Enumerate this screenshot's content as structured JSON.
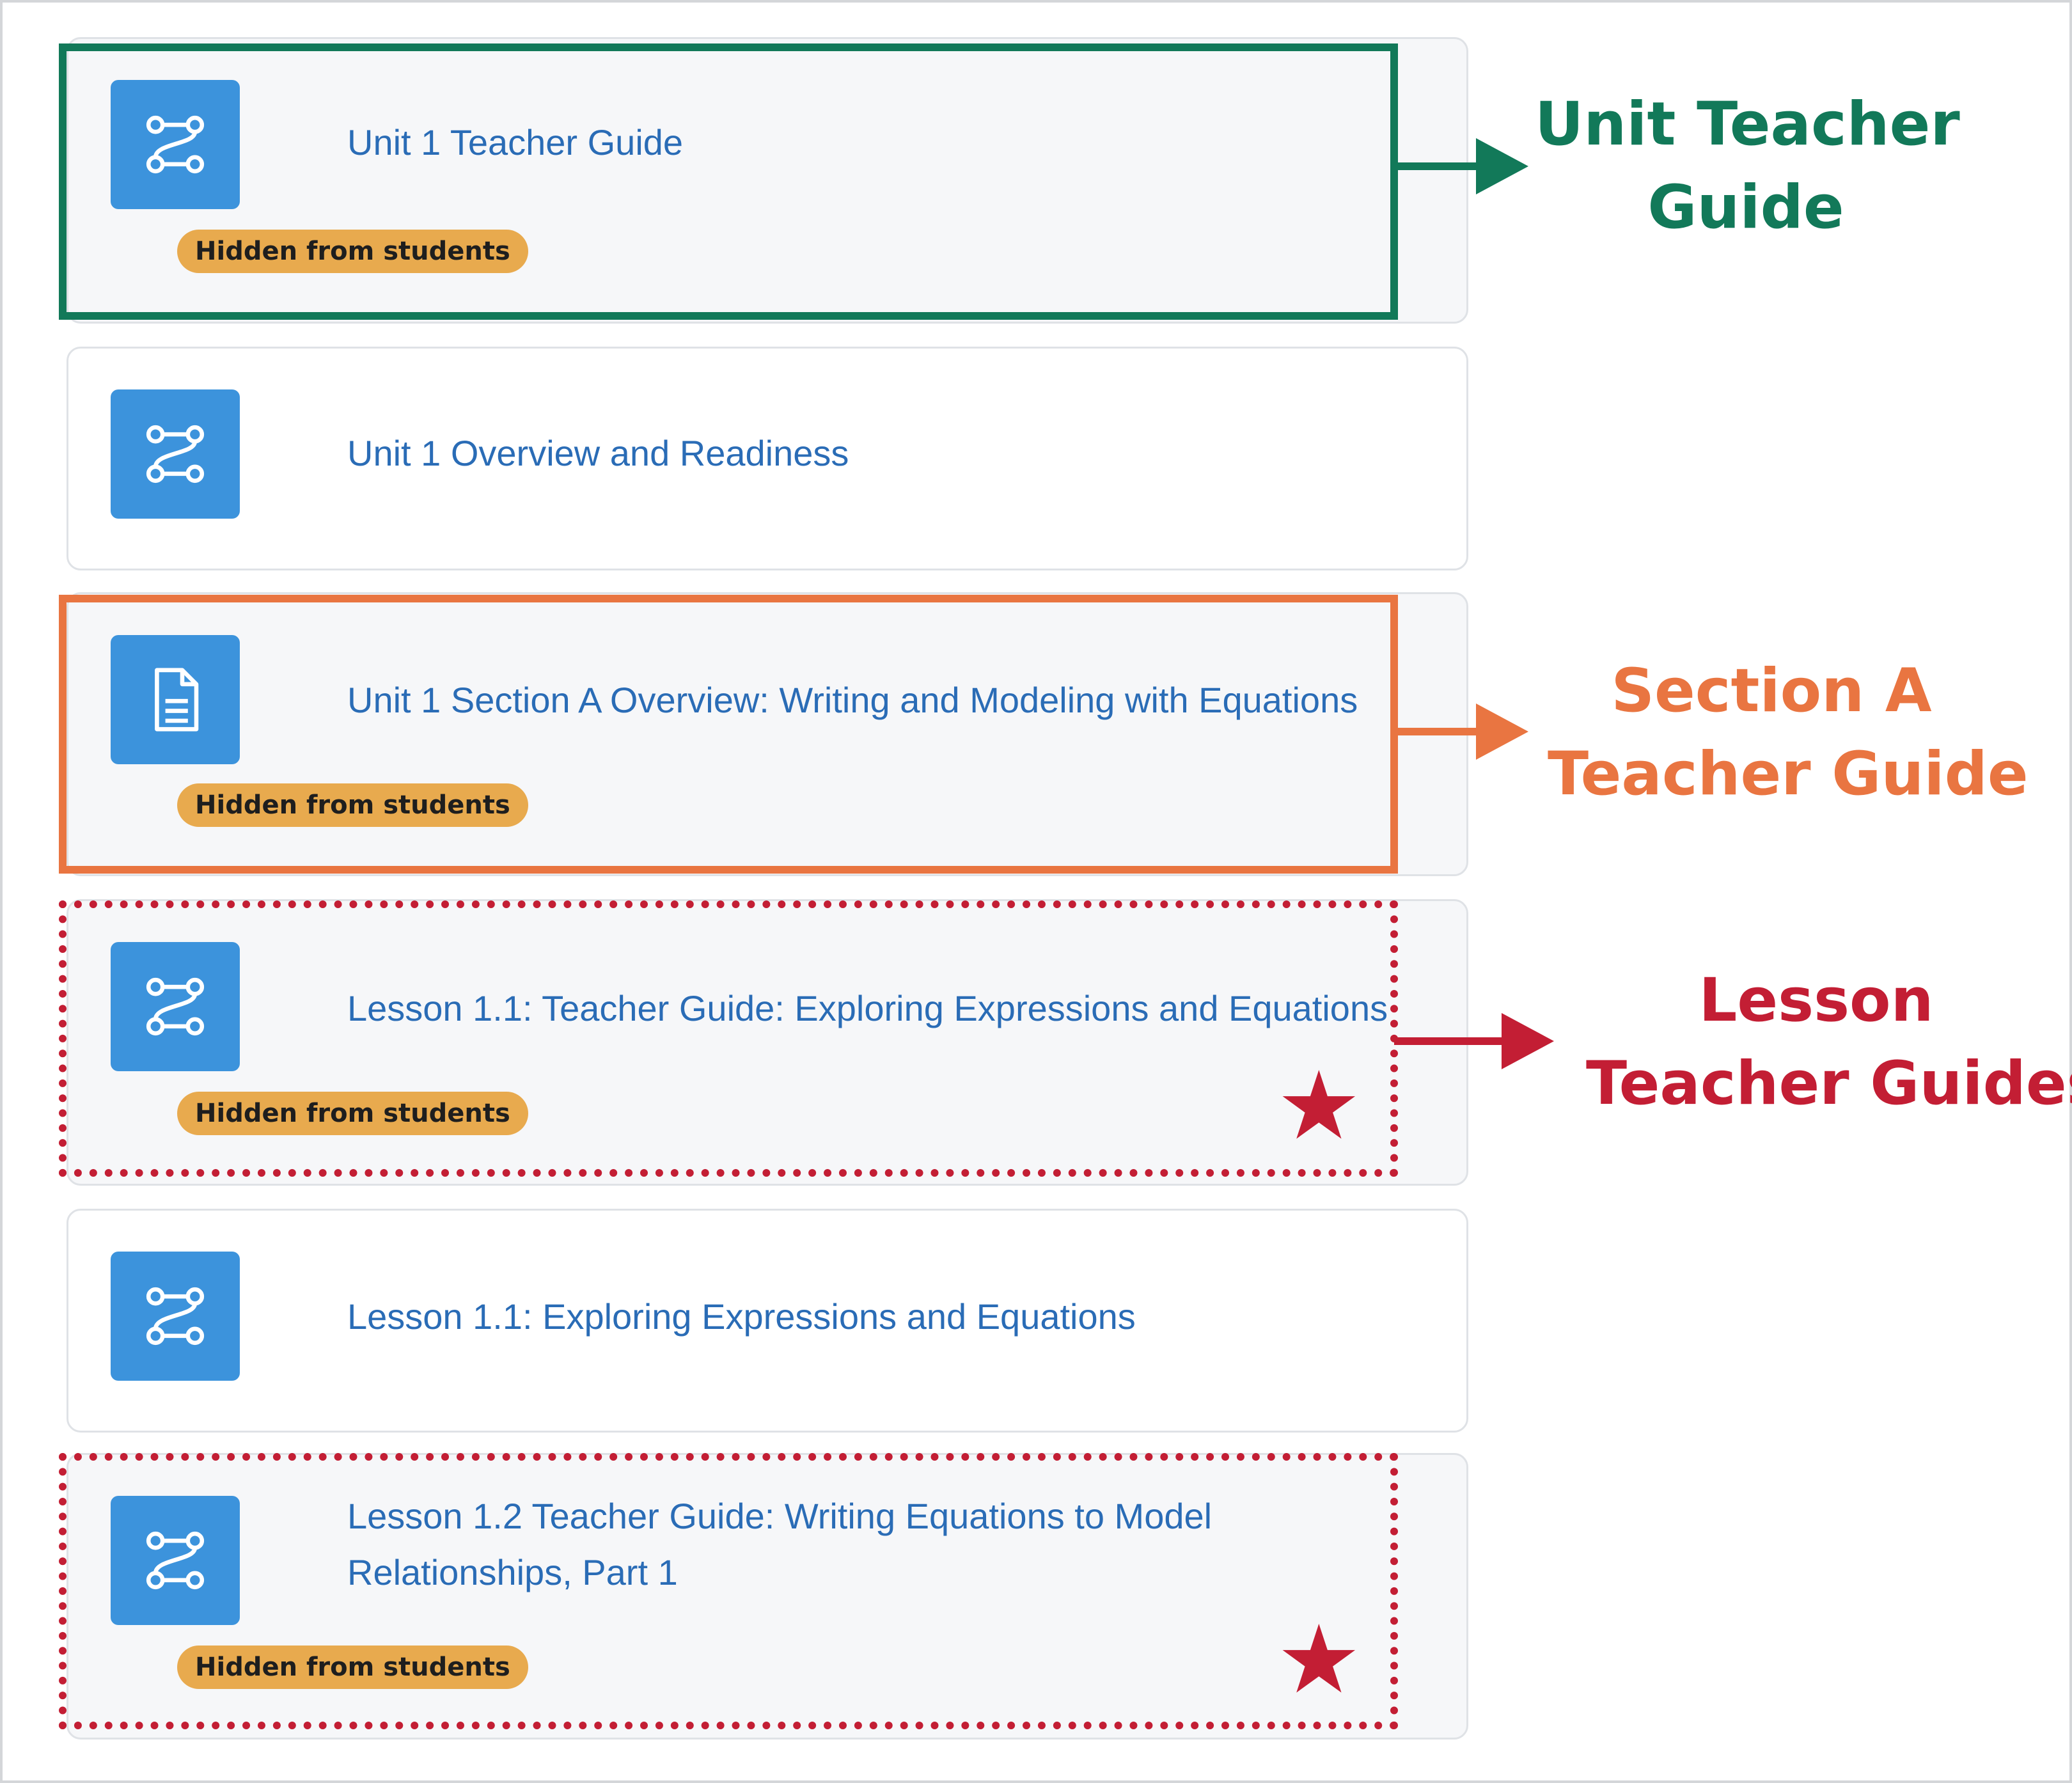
{
  "activities": [
    {
      "title": "Unit 1 Teacher Guide",
      "icon": "route-icon",
      "badge": "Hidden from students"
    },
    {
      "title": "Unit 1 Overview and Readiness",
      "icon": "route-icon"
    },
    {
      "title": "Unit 1 Section A Overview: Writing and Modeling with Equations",
      "icon": "page-icon",
      "badge": "Hidden from students"
    },
    {
      "title": "Lesson 1.1: Teacher Guide: Exploring Expressions and Equations",
      "icon": "route-icon",
      "badge": "Hidden from students"
    },
    {
      "title": "Lesson 1.1: Exploring Expressions and Equations",
      "icon": "route-icon"
    },
    {
      "title": "Lesson 1.2 Teacher Guide: Writing Equations to Model Relationships, Part 1",
      "icon": "route-icon",
      "badge": "Hidden from students"
    }
  ],
  "callouts": {
    "unit": {
      "line1": "Unit Teacher",
      "line2": "Guide"
    },
    "section": {
      "line1": "Section A",
      "line2": "Teacher Guide"
    },
    "lesson": {
      "line1": "Lesson",
      "line2": "Teacher Guides"
    }
  },
  "colors": {
    "unit_callout": "#127959",
    "section_callout": "#e97541",
    "lesson_callout": "#c31e34",
    "icon_tile": "#3c93dc",
    "link_text": "#2a6cb6",
    "badge": "#e8aa4e"
  }
}
